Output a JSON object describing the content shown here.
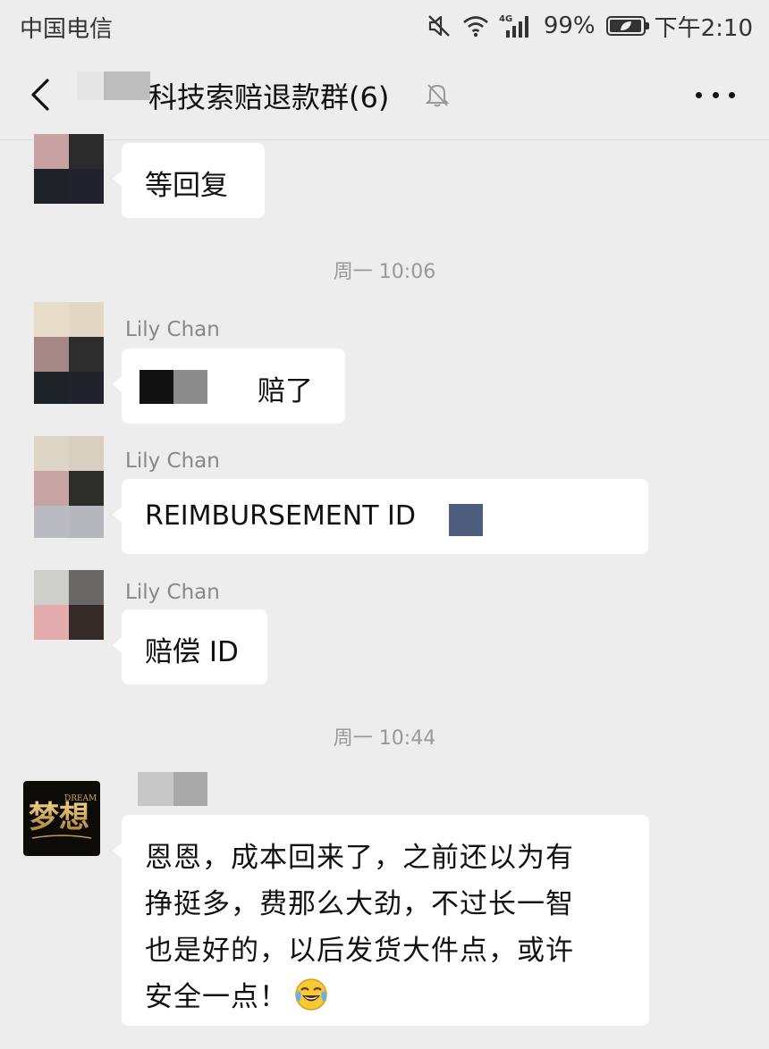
{
  "status_bar": {
    "carrier": "中国电信",
    "network": "4G",
    "battery_percent": "99%",
    "battery_level": 0.99,
    "time": "下午2:10",
    "icons": [
      "mute-icon",
      "wifi-icon",
      "signal-icon",
      "battery-icon"
    ]
  },
  "nav": {
    "title": "科技索赔退款群(6)",
    "icons": [
      "back-chevron-icon",
      "muted-bell-icon",
      "more-dots-icon"
    ]
  },
  "messages": [
    {
      "type": "text",
      "sender": "",
      "text": "等回复"
    },
    {
      "type": "timestamp",
      "text": "周一 10:06"
    },
    {
      "type": "text",
      "sender": "Lily Chan",
      "text": "赔了"
    },
    {
      "type": "text",
      "sender": "Lily Chan",
      "text": "REIMBURSEMENT ID"
    },
    {
      "type": "text",
      "sender": "Lily Chan",
      "text": "赔偿 ID"
    },
    {
      "type": "timestamp",
      "text": "周一 10:44"
    },
    {
      "type": "text",
      "sender": "",
      "lines": [
        "恩恩，成本回来了，之前还以为有",
        "挣挺多，费那么大劲，不过长一智",
        "也是好的，以后发货大件点，或许",
        "安全一点！"
      ],
      "emoji": "face-with-tears-of-joy-icon"
    }
  ],
  "avatar_dream": {
    "text_main": "梦想",
    "text_small": "DREAM"
  },
  "colors": {
    "background": "#ededed",
    "bubble": "#ffffff",
    "timestamp": "#999999",
    "sender_name": "#888888"
  }
}
